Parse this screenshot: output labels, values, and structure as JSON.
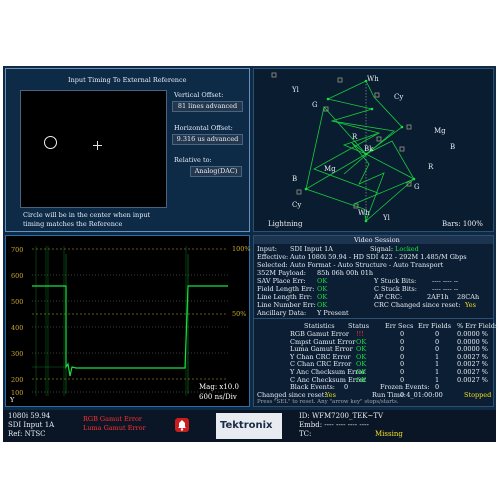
{
  "timing": {
    "title": "Input Timing To External Reference",
    "vertical_offset_label": "Vertical Offset:",
    "vertical_offset_value": "81 lines advanced",
    "horizontal_offset_label": "Horizontal Offset:",
    "horizontal_offset_value": "9.316 us advanced",
    "relative_label": "Relative to:",
    "relative_value": "Analog(DAC)",
    "note_line1": "Circle will be in the center when input",
    "note_line2": "timing matches the Reference"
  },
  "lightning": {
    "title": "Lightning",
    "bars": "Bars: 100%",
    "labels": [
      "Wh",
      "Yl",
      "Cy",
      "G",
      "Mg",
      "R",
      "B",
      "Bk",
      "R",
      "Mg",
      "B",
      "G",
      "Cy",
      "Wh",
      "Yl"
    ]
  },
  "waveform": {
    "ticks": [
      "700",
      "600",
      "500",
      "400",
      "300",
      "200",
      "100"
    ],
    "pct_100": "100%",
    "pct_50": "50%",
    "mag": "Mag: x10.0",
    "scale": "600 ns/Div",
    "y_label": "Y"
  },
  "session": {
    "title": "Video Session",
    "input_label": "Input:",
    "input_value": "SDI Input 1A",
    "signal_label": "Signal:",
    "signal_value": "Locked",
    "effective_label": "Effective:",
    "effective_value": "Auto 1080i 59.94 - HD SDI 422 - 292M 1.485/M Gbps",
    "selected_label": "Selected:",
    "selected_value": "Auto Format - Auto Structure - Auto Transport",
    "payload_label": "352M Payload:",
    "payload_value": "85h 06h 00h 01h",
    "sav_label": "SAV Place Err:",
    "sav_value": "OK",
    "ystuck_label": "Y Stuck Bits:",
    "ystuck_value": "---- ---- --",
    "fieldlen_label": "Field Length Err:",
    "fieldlen_value": "OK",
    "cstuck_label": "C Stuck Bits:",
    "cstuck_value": "---- ---- --",
    "linelen_label": "Line Length Err:",
    "linelen_value": "OK",
    "apcrc_label": "AP CRC:",
    "apcrc_value1": "2AF1h",
    "apcrc_value2": "28CAh",
    "linenum_label": "Line Number Err:",
    "linenum_value": "OK",
    "crcchanged_label": "CRC Changed since reset:",
    "crcchanged_value": "Yes",
    "ancillary_label": "Ancillary Data:",
    "ancillary_value": "Y Present"
  },
  "stats": {
    "headers": [
      "Statistics",
      "Status",
      "Err Secs",
      "Err Fields",
      "% Err Fields"
    ],
    "rows": [
      {
        "name": "RGB Gamut Error",
        "status": "!!!",
        "status_color": "red",
        "secs": "0",
        "fields": "0",
        "pct": "0.0000 %"
      },
      {
        "name": "Cmpst Gamut Error",
        "status": "OK",
        "status_color": "green",
        "secs": "0",
        "fields": "0",
        "pct": "0.0000 %"
      },
      {
        "name": "Luma Gamut Error",
        "status": "OK",
        "status_color": "green",
        "secs": "0",
        "fields": "0",
        "pct": "0.0000 %"
      },
      {
        "name": "Y Chan CRC Error",
        "status": "OK",
        "status_color": "green",
        "secs": "0",
        "fields": "1",
        "pct": "0.0027 %"
      },
      {
        "name": "C Chan CRC Error",
        "status": "OK",
        "status_color": "green",
        "secs": "0",
        "fields": "1",
        "pct": "0.0027 %"
      },
      {
        "name": "Y Anc Checksum Error",
        "status": "OK",
        "status_color": "green",
        "secs": "0",
        "fields": "1",
        "pct": "0.0027 %"
      },
      {
        "name": "C Anc Checksum Error",
        "status": "OK",
        "status_color": "green",
        "secs": "0",
        "fields": "1",
        "pct": "0.0027 %"
      }
    ],
    "black_label": "Black Events:",
    "black_value": "0",
    "frozen_label": "Frozen Events:",
    "frozen_value": "0",
    "changed_label": "Changed since reset:",
    "changed_value": "Yes",
    "runtime_label": "Run Time:",
    "runtime_value": "0 4_01:00:00",
    "status_value": "Stopped",
    "hint": "Press \"SEL\" to reset.   Any \"arrow key\" stops/starts."
  },
  "status_bar": {
    "format": "1080i 59.94",
    "input": "SDI Input 1A",
    "ref": "Ref: NTSC",
    "alarm1": "RGB Gamut Error",
    "alarm2": "Luma Gamut Error",
    "brand": "Tektronix",
    "id": "ID: WFM7200_TEK~TV",
    "embd": "Embd: ---- ---- ---- ----",
    "tc_label": "TC:",
    "tc_value": "Missing"
  },
  "colors": {
    "trace_green": "#19e040",
    "ok_green": "#19e040",
    "alarm_red": "#ff3030",
    "warn_yellow": "#f0e020"
  }
}
